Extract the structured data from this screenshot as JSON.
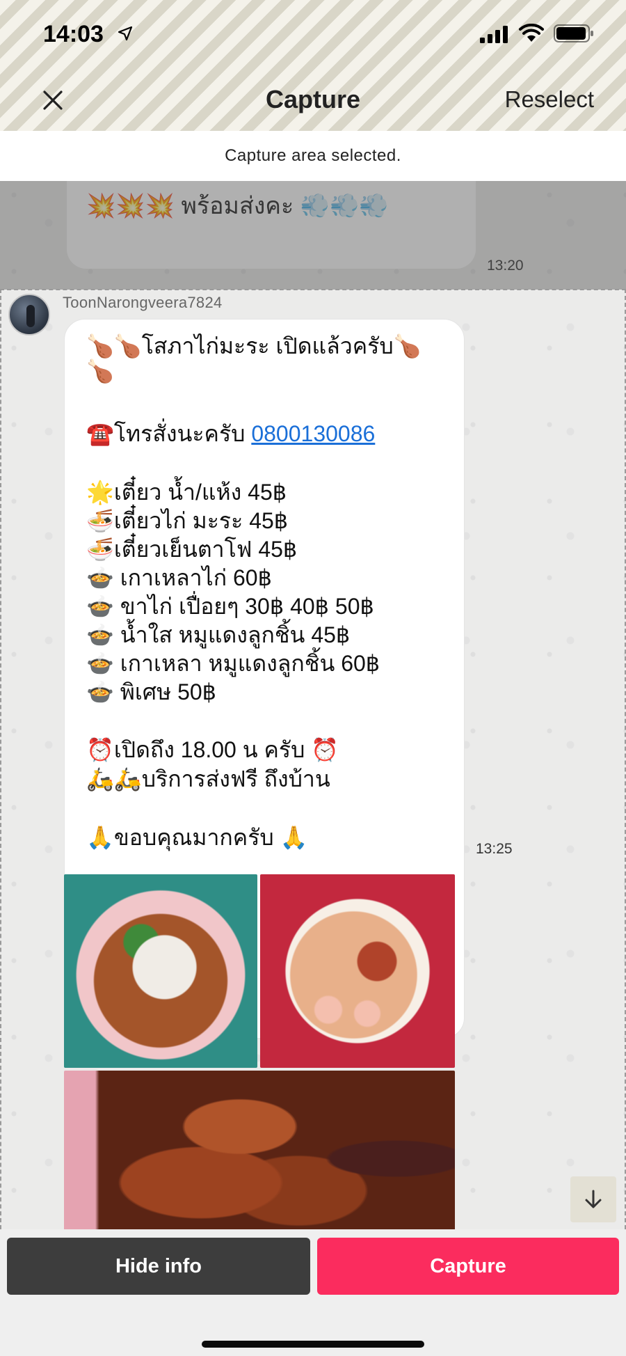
{
  "status_bar": {
    "time": "14:03"
  },
  "nav": {
    "title": "Capture",
    "reselect_label": "Reselect"
  },
  "notice": "Capture area selected.",
  "previous_message": {
    "text": "💥💥💥 พร้อมส่งคะ 💨💨💨",
    "time": "13:20"
  },
  "message": {
    "username": "ToonNarongveera7824",
    "time": "13:25",
    "phone": "0800130086",
    "lines": [
      "🍗🍗โสภาไก่มะระ เปิดแล้วครับ🍗",
      "🍗",
      "☎️โทรสั่งนะครับ ",
      "🌟เตี๋ยว น้ำ/แห้ง 45฿",
      "🍜เตี๋ยวไก่ มะระ 45฿",
      "🍜เตี๋ยวเย็นตาโฟ 45฿",
      "🍲 เกาเหลาไก่ 60฿",
      "🍲 ขาไก่ เปื่อยๆ 30฿ 40฿ 50฿",
      "🍲 น้ำใส หมูแดงลูกชิ้น 45฿",
      "🍲 เกาเหลา หมูแดงลูกชิ้น 60฿",
      "🍲 พิเศษ 50฿",
      "⏰เปิดถึง 18.00 น ครับ ⏰",
      "🛵🛵บริการส่งฟรี ถึงบ้าน",
      "🙏ขอบคุณมากครับ 🙏"
    ]
  },
  "buttons": {
    "hide_info": "Hide info",
    "capture": "Capture"
  }
}
